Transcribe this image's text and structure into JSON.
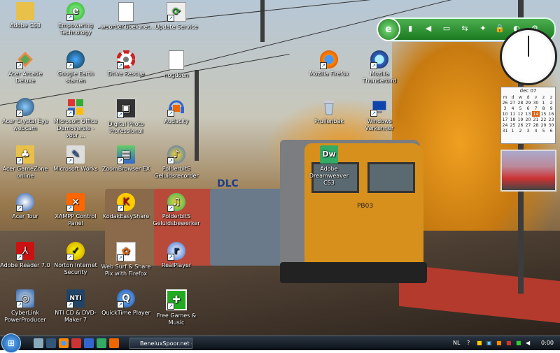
{
  "desktop": {
    "icons": [
      {
        "label": "Adobe CS3",
        "icon": "folder-icon"
      },
      {
        "label": "Empowering Technology",
        "icon": "empowering-technology-icon"
      },
      {
        "label": "woordenboek.net...",
        "icon": "document-icon"
      },
      {
        "label": "Update Service",
        "icon": "update-service-icon"
      },
      {
        "label": "Acer Arcade Deluxe",
        "icon": "acer-arcade-icon"
      },
      {
        "label": "Google Earth starten",
        "icon": "google-earth-icon"
      },
      {
        "label": "Drive Rescue",
        "icon": "lifebuoy-icon"
      },
      {
        "label": "nogdoen",
        "icon": "text-file-icon"
      },
      {
        "label": "Mozilla Firefox",
        "icon": "firefox-icon"
      },
      {
        "label": "Mozilla Thunderbird",
        "icon": "thunderbird-icon"
      },
      {
        "label": "Acer Crystal Eye webcam",
        "icon": "webcam-icon"
      },
      {
        "label": "Microsoft Office Demoversie - voor ...",
        "icon": "office-icon"
      },
      {
        "label": "Digital Photo Professional",
        "icon": "photo-professional-icon"
      },
      {
        "label": "Audacity",
        "icon": "audacity-icon"
      },
      {
        "label": "Prullenbak",
        "icon": "recycle-bin-icon"
      },
      {
        "label": "Windows Verkenner",
        "icon": "explorer-icon"
      },
      {
        "label": "Acer GameZone online",
        "icon": "gamezone-icon"
      },
      {
        "label": "Microsoft Works",
        "icon": "works-icon"
      },
      {
        "label": "ZoomBrowser EX",
        "icon": "zoombrowser-icon"
      },
      {
        "label": "PolderbitS Geluidsrecorder",
        "icon": "polderbits-recorder-icon"
      },
      {
        "label": "Adobe Dreamweaver CS3",
        "icon": "dreamweaver-icon"
      },
      {
        "label": "Acer Tour",
        "icon": "acer-tour-icon"
      },
      {
        "label": "XAMPP Control Panel",
        "icon": "xampp-icon"
      },
      {
        "label": "KodakEasyShare",
        "icon": "kodak-icon"
      },
      {
        "label": "PolderbitS Geluidsbewerker",
        "icon": "polderbits-editor-icon"
      },
      {
        "label": "Adobe Reader 7.0",
        "icon": "adobe-reader-icon"
      },
      {
        "label": "Norton Internet Security",
        "icon": "norton-icon"
      },
      {
        "label": "Web Surf & Share Pix with Firefox",
        "icon": "websurf-icon"
      },
      {
        "label": "RealPlayer",
        "icon": "realplayer-icon"
      },
      {
        "label": "CyberLink PowerProducer",
        "icon": "powerproducer-icon"
      },
      {
        "label": "NTI CD & DVD-Maker 7",
        "icon": "nti-icon"
      },
      {
        "label": "QuickTime Player",
        "icon": "quicktime-icon"
      },
      {
        "label": "Free Games & Music",
        "icon": "gift-icon"
      }
    ]
  },
  "wallpaper": {
    "locomotive_number": "PB03",
    "locomotive_logo": "DLC"
  },
  "sidebar": {
    "calendar": {
      "month_label": "dec 07",
      "weekdays": [
        "m",
        "d",
        "w",
        "d",
        "v",
        "z",
        "z"
      ],
      "weeks": [
        [
          "26",
          "27",
          "28",
          "29",
          "30",
          "1",
          "2"
        ],
        [
          "3",
          "4",
          "5",
          "6",
          "7",
          "8",
          "9"
        ],
        [
          "10",
          "11",
          "12",
          "13",
          "14",
          "15",
          "16"
        ],
        [
          "17",
          "18",
          "19",
          "20",
          "21",
          "22",
          "23"
        ],
        [
          "24",
          "25",
          "26",
          "27",
          "28",
          "29",
          "30"
        ],
        [
          "31",
          "1",
          "2",
          "3",
          "4",
          "5",
          "6"
        ]
      ],
      "today": "14"
    }
  },
  "taskbar": {
    "task_label": "BeneluxSpoor.net - ...",
    "language": "NL",
    "time": "0:00"
  },
  "colors": {
    "gadget_green": "#2e8b32",
    "calendar_today": "#e06010"
  }
}
